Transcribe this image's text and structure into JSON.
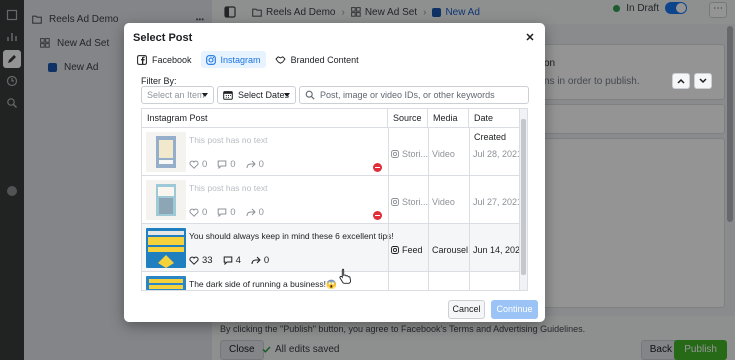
{
  "app": {
    "tree": {
      "campaign": "Reels Ad Demo",
      "ad_set": "New Ad Set",
      "ad": "New Ad",
      "more": "•••"
    },
    "breadcrumb": {
      "campaign": "Reels Ad Demo",
      "ad_set": "New Ad Set",
      "ad": "New Ad"
    },
    "status": "In Draft",
    "notice_title": "on",
    "notice_body": "ns in order to publish.",
    "footer": {
      "legal": "By clicking the \"Publish\" button, you agree to Facebook's Terms and Advertising Guidelines.",
      "close": "Close",
      "saved": "All edits saved",
      "back": "Back",
      "publish": "Publish"
    }
  },
  "modal": {
    "title": "Select Post",
    "tabs": [
      {
        "label": "Facebook",
        "icon": "facebook-icon",
        "active": false
      },
      {
        "label": "Instagram",
        "icon": "instagram-icon",
        "active": true
      },
      {
        "label": "Branded Content",
        "icon": "handshake-icon",
        "active": false
      }
    ],
    "filter_label": "Filter By:",
    "item_select_placeholder": "Select an Item",
    "date_select_label": "Select Dates",
    "search_placeholder": "Post, image or video IDs, or other keywords",
    "columns": [
      "Instagram Post",
      "Source",
      "Media",
      "Date Created"
    ],
    "rows": [
      {
        "text": "This post has no text",
        "likes": "0",
        "comments": "0",
        "shares": "0",
        "source": "Stori...",
        "media": "Video",
        "date": "Jul 28, 2021",
        "disabled": true,
        "warning": true
      },
      {
        "text": "This post has no text",
        "likes": "0",
        "comments": "0",
        "shares": "0",
        "source": "Stori...",
        "media": "Video",
        "date": "Jul 27, 2021",
        "disabled": true,
        "warning": true
      },
      {
        "text": "You should always keep in mind these 6 excellent tips!",
        "likes": "33",
        "comments": "4",
        "shares": "0",
        "source": "Feed",
        "media": "Carousel",
        "date": "Jun 14, 2021",
        "disabled": false,
        "warning": false
      },
      {
        "text": "The dark side of running a business!😱",
        "likes": "",
        "comments": "",
        "shares": "",
        "source": "",
        "media": "",
        "date": "",
        "disabled": false,
        "warning": false
      }
    ],
    "cancel": "Cancel",
    "continue": "Continue"
  },
  "colors": {
    "accent": "#1877f2",
    "active_tab_bg": "#e7f3ff",
    "publish": "#42b72a",
    "continue_disabled": "#9cc3f6",
    "warning": "#e02f3a"
  }
}
